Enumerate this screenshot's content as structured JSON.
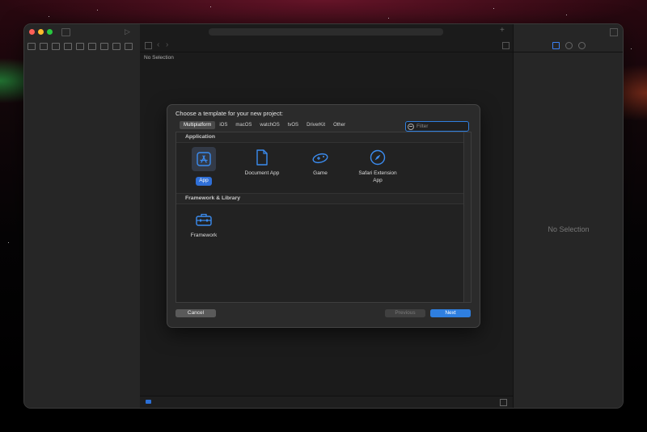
{
  "editor": {
    "no_selection": "No Selection"
  },
  "inspector": {
    "no_selection": "No Selection"
  },
  "dialog": {
    "title": "Choose a template for your new project:",
    "platform_tabs": [
      "Multiplatform",
      "iOS",
      "macOS",
      "watchOS",
      "tvOS",
      "DriverKit",
      "Other"
    ],
    "selected_tab": "Multiplatform",
    "filter_placeholder": "Filter",
    "sections": [
      {
        "header": "Application",
        "templates": [
          {
            "label": "App",
            "icon": "app-store-a-icon",
            "selected": true
          },
          {
            "label": "Document App",
            "icon": "document-icon",
            "selected": false
          },
          {
            "label": "Game",
            "icon": "gamepad-icon",
            "selected": false
          },
          {
            "label": "Safari Extension App",
            "icon": "compass-icon",
            "selected": false
          }
        ]
      },
      {
        "header": "Framework & Library",
        "templates": [
          {
            "label": "Framework",
            "icon": "toolbox-icon",
            "selected": false
          }
        ]
      }
    ],
    "buttons": {
      "cancel": "Cancel",
      "previous": "Previous",
      "next": "Next"
    }
  },
  "colors": {
    "accent": "#2f7fe0",
    "selected_label": "#2f6fd7"
  }
}
